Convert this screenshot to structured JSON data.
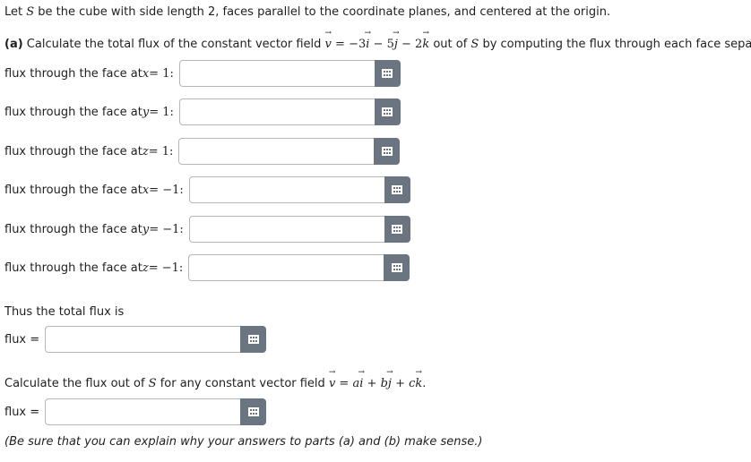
{
  "intro": {
    "a": "Let ",
    "S": "S",
    "b": " be the cube with side length 2, faces parallel to the coordinate planes, and centered at the origin."
  },
  "part_a": {
    "label": "(a)",
    "text1": " Calculate the total flux of the constant vector field ",
    "v": "v",
    "eq": " = −3",
    "i": "i",
    "minus5": " − 5",
    "j": "j",
    "minus2": " − 2",
    "k": "k",
    "text2": " out of ",
    "S": "S",
    "text3": " by computing the flux through each face separately."
  },
  "faces": [
    {
      "prefix": "flux through the face at ",
      "var": "x",
      "eq": " = 1:",
      "value": ""
    },
    {
      "prefix": "flux through the face at ",
      "var": "y",
      "eq": " = 1:",
      "value": ""
    },
    {
      "prefix": "flux through the face at ",
      "var": "z",
      "eq": " = 1:",
      "value": ""
    },
    {
      "prefix": "flux through the face at ",
      "var": "x",
      "eq": " = −1:",
      "value": ""
    },
    {
      "prefix": "flux through the face at ",
      "var": "y",
      "eq": " = −1:",
      "value": ""
    },
    {
      "prefix": "flux through the face at ",
      "var": "z",
      "eq": " = −1:",
      "value": ""
    }
  ],
  "total": {
    "text": "Thus the total flux is",
    "flux_label": "flux =",
    "value": ""
  },
  "part_b": {
    "text1": "Calculate the flux out of ",
    "S": "S",
    "text2": " for any constant vector field ",
    "v": "v",
    "eq": " = ",
    "a": "a",
    "i": "i",
    "plus1": " + ",
    "b": "b",
    "j": "j",
    "plus2": " + ",
    "c": "c",
    "k": "k",
    "end": ".",
    "flux_label": "flux =",
    "value": ""
  },
  "note": "(Be sure that you can explain why your answers to parts (a) and (b) make sense.)",
  "icons": {
    "answer_button": "grid-icon"
  },
  "colors": {
    "button_bg": "#6b7581",
    "input_border": "#b7b7b7"
  }
}
